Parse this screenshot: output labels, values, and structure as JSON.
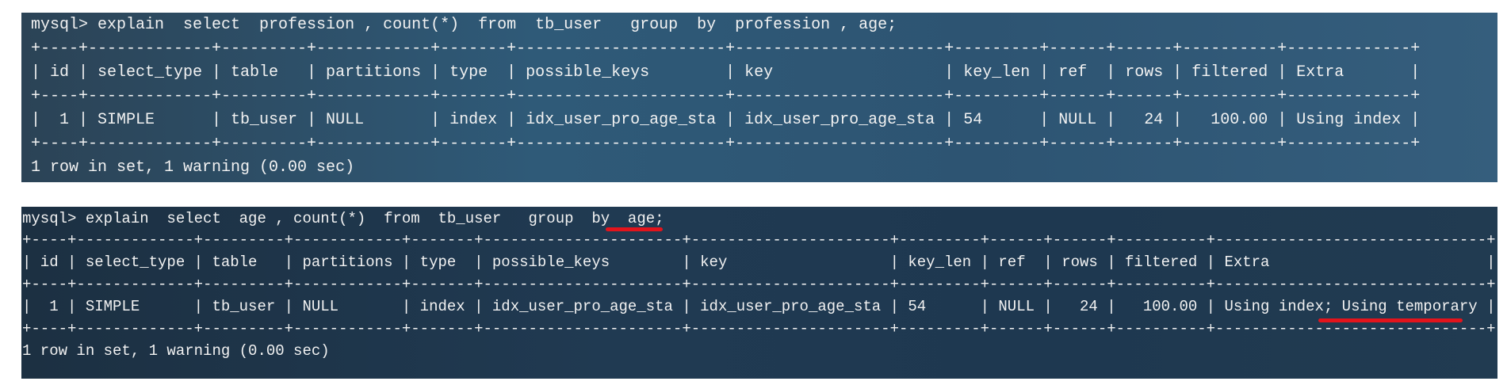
{
  "terminal_top": {
    "command": "mysql> explain  select  profession , count(*)  from  tb_user   group  by  profession , age;",
    "border_top": "+----+-------------+---------+------------+-------+----------------------+----------------------+---------+------+------+----------+-------------+",
    "header": "| id | select_type | table   | partitions | type  | possible_keys        | key                  | key_len | ref  | rows | filtered | Extra       |",
    "border_mid": "+----+-------------+---------+------------+-------+----------------------+----------------------+---------+------+------+----------+-------------+",
    "row": "|  1 | SIMPLE      | tb_user | NULL       | index | idx_user_pro_age_sta | idx_user_pro_age_sta | 54      | NULL |   24 |   100.00 | Using index |",
    "border_bottom": "+----+-------------+---------+------------+-------+----------------------+----------------------+---------+------+------+----------+-------------+",
    "footer": "1 row in set, 1 warning (0.00 sec)"
  },
  "terminal_bottom": {
    "command": "mysql> explain  select  age , count(*)  from  tb_user   group  by  age;",
    "border_top": "+----+-------------+---------+------------+-------+----------------------+----------------------+---------+------+------+----------+------------------------------+",
    "header": "| id | select_type | table   | partitions | type  | possible_keys        | key                  | key_len | ref  | rows | filtered | Extra                        |",
    "border_mid": "+----+-------------+---------+------------+-------+----------------------+----------------------+---------+------+------+----------+------------------------------+",
    "row": "|  1 | SIMPLE      | tb_user | NULL       | index | idx_user_pro_age_sta | idx_user_pro_age_sta | 54      | NULL |   24 |   100.00 | Using index; Using temporary |",
    "border_bottom": "+----+-------------+---------+------------+-------+----------------------+----------------------+---------+------+------+----------+------------------------------+",
    "footer": "1 row in set, 1 warning (0.00 sec)"
  },
  "colors": {
    "terminal_text": "#f2f2f2",
    "highlight": "#e3141c"
  }
}
